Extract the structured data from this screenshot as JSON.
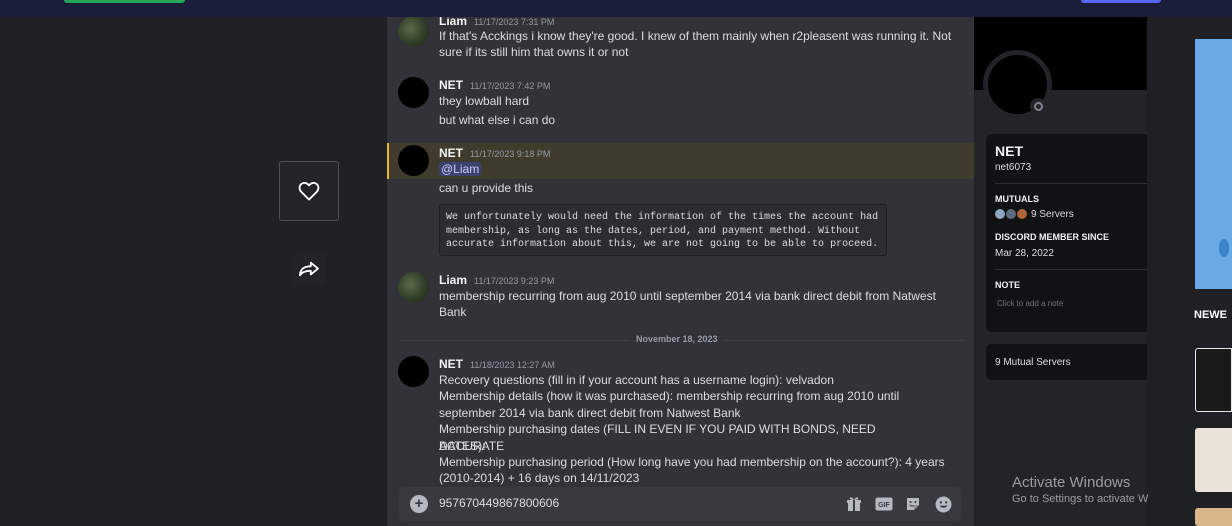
{
  "messages": [
    {
      "author": "Liam",
      "time": "11/17/2023 7:31 PM",
      "lines": [
        "If that's Acckings i know they're good. I knew of them mainly when r2pleasent was running it. Not",
        "sure if its still him that owns it or not"
      ]
    },
    {
      "author": "NET",
      "time": "11/17/2023 7:42 PM",
      "lines": [
        "they lowball hard",
        "but what else i can do"
      ]
    },
    {
      "author": "NET",
      "time": "11/17/2023 9:18 PM",
      "mention": "@Liam",
      "lines": [
        "can  u provide this"
      ],
      "code": "We unfortunately would need the information of the times the account had\nmembership, as long as the dates, period, and payment method. Without\naccurate information about this, we are not going to be able to proceed."
    },
    {
      "author": "Liam",
      "time": "11/17/2023 9:23 PM",
      "lines": [
        "membership recurring from aug 2010 until september 2014 via bank direct debit from Natwest",
        "Bank"
      ]
    },
    {
      "author": "NET",
      "time": "11/18/2023 12:27 AM",
      "lines": [
        "Recovery questions (fill in if your account has a username login): velvadon",
        "Membership details (how it was purchased):  membership recurring from aug 2010 until",
        "september 2014 via bank direct debit from Natwest Bank",
        "Membership purchasing dates (FILL IN EVEN IF YOU PAID WITH BONDS, NEED ACCURATE",
        "DATES):",
        "Membership purchasing period (How long have you had membership on the account?): 4 years",
        "(2010-2014) + 16 days on 14/11/2023"
      ]
    }
  ],
  "date_divider": "November 18, 2023",
  "input": {
    "value": "957670449867800606"
  },
  "profile": {
    "display_name": "NET",
    "username": "net6073",
    "mutuals_title": "MUTUALS",
    "mutuals_value": "9 Servers",
    "member_since_title": "DISCORD MEMBER SINCE",
    "member_since_value": "Mar 28, 2022",
    "note_title": "NOTE",
    "note_placeholder": "Click to add a note",
    "mutual_servers": "9 Mutual Servers"
  },
  "sidebar_right": {
    "heading": "NEWE"
  },
  "watermark": {
    "line1": "Activate Windows",
    "line2": "Go to Settings to activate W"
  },
  "colors": {
    "mention_bg": "#3c4270",
    "highlight_bg": "#3f3c2d",
    "highlight_border": "#f0b232",
    "status_offline": "#80848e"
  }
}
